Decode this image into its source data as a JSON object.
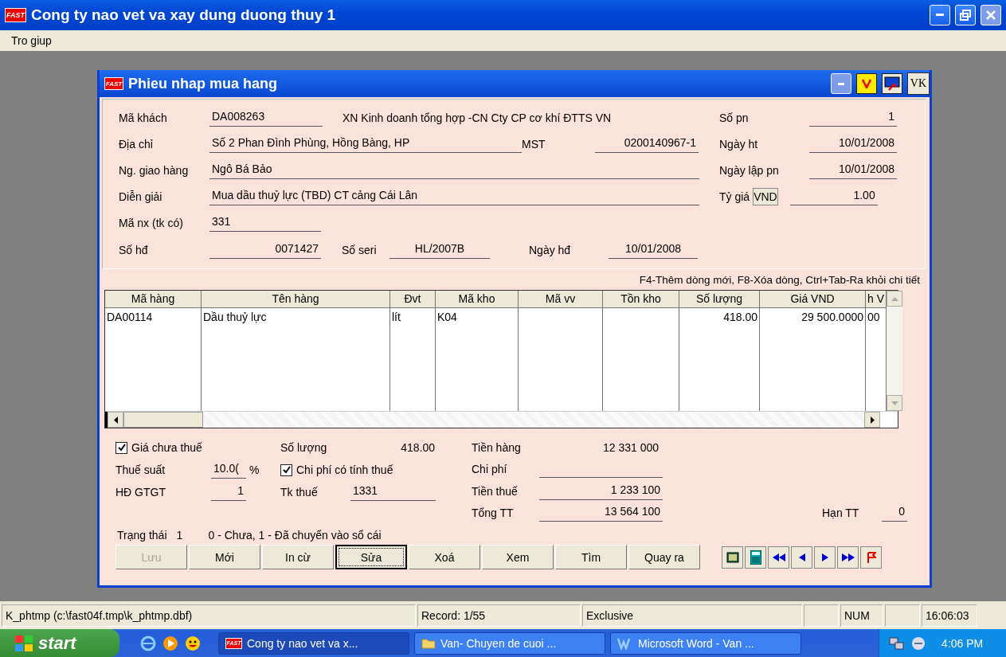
{
  "window": {
    "logo": "FAST",
    "title": "Cong ty nao vet va xay dung duong thuy 1"
  },
  "menu": [
    "Tro giup"
  ],
  "dialog": {
    "logo": "FAST",
    "title": "Phieu nhap mua hang",
    "corner_label": "VK",
    "customer_code": {
      "label": "Mã khách",
      "value": "DA008263",
      "name": "XN Kinh doanh tổng hợp -CN Cty CP cơ khí ĐTTS VN"
    },
    "address": {
      "label": "Địa chỉ",
      "value": "Số 2 Phan Đình Phùng, Hồng Bàng, HP",
      "tax_label": "MST",
      "tax_value": "0200140967-1"
    },
    "deliverer": {
      "label": "Ng. giao hàng",
      "value": "Ngô Bá Bảo"
    },
    "description": {
      "label": "Diễn giải",
      "value": "Mua dầu thuỷ lực (TBD) CT cảng Cái Lân"
    },
    "account": {
      "label": "Mã nx (tk có)",
      "value": "331"
    },
    "invoice": {
      "label": "Số hđ",
      "value": "0071427",
      "serial_label": "Số seri",
      "serial_value": "HL/2007B",
      "date_label": "Ngày hđ",
      "date_value": "10/01/2008"
    },
    "right_fields": [
      {
        "label": "Số pn",
        "value": "1"
      },
      {
        "label": "Ngày ht",
        "value": "10/01/2008"
      },
      {
        "label": "Ngày lập pn",
        "value": "10/01/2008"
      },
      {
        "label": "Tỷ giá",
        "currency": "VND",
        "value": "1.00"
      }
    ],
    "hint": "F4-Thêm dòng mới, F8-Xóa dòng, Ctrl+Tab-Ra khỏi chi tiết",
    "table": {
      "columns": [
        "Mã hàng",
        "Tên hàng",
        "Đvt",
        "Mã kho",
        "Mã vv",
        "Tồn kho",
        "Số lượng",
        "Giá VND",
        "h V"
      ],
      "rows": [
        [
          "DA00114",
          "Dầu thuỷ lực",
          "lít",
          "K04",
          "",
          "",
          "418.00",
          "29 500.0000",
          "00"
        ]
      ]
    },
    "price_excl_tax": {
      "label": "Giá chưa thuế",
      "checked": true
    },
    "tax_rate": {
      "label": "Thuế suất",
      "value": "10.0(",
      "unit": "%"
    },
    "vat_invoice": {
      "label": "HĐ GTGT",
      "value": "1"
    },
    "quantity": {
      "label": "Số lượng",
      "value": "418.00"
    },
    "cost_taxable": {
      "label": "Chi phí có tính thuế",
      "checked": true
    },
    "tax_account": {
      "label": "Tk thuế",
      "value": "1331"
    },
    "goods_amount": {
      "label": "Tiền hàng",
      "value": "12 331 000"
    },
    "cost": {
      "label": "Chi phí"
    },
    "tax_amount": {
      "label": "Tiền thuế",
      "value": "1 233 100"
    },
    "total": {
      "label": "Tổng TT",
      "value": "13 564 100"
    },
    "due": {
      "label": "Hạn TT",
      "value": "0"
    },
    "status": {
      "label": "Trạng thái",
      "value": "1",
      "legend": "0 - Chưa, 1 - Đã chuyển vào sổ cái"
    },
    "buttons": [
      {
        "label": "Lưu",
        "disabled": true,
        "focused": false
      },
      {
        "label": "Mới",
        "disabled": false,
        "focused": false
      },
      {
        "label": "In cừ",
        "disabled": false,
        "focused": false
      },
      {
        "label": "Sửa",
        "disabled": false,
        "focused": true
      },
      {
        "label": "Xoá",
        "disabled": false,
        "focused": false
      },
      {
        "label": "Xem",
        "disabled": false,
        "focused": false
      },
      {
        "label": "Tìm",
        "disabled": false,
        "focused": false
      },
      {
        "label": "Quay ra",
        "disabled": false,
        "focused": false
      }
    ],
    "nav_buttons": [
      {
        "kind": "ledger"
      },
      {
        "kind": "calculator"
      },
      {
        "kind": "first"
      },
      {
        "kind": "prev"
      },
      {
        "kind": "next"
      },
      {
        "kind": "last"
      },
      {
        "kind": "flag"
      }
    ]
  },
  "status_bar": {
    "file": "K_phtmp (c:\\fast04f.tmp\\k_phtmp.dbf)",
    "record": "Record: 1/55",
    "mode": "Exclusive",
    "num_lock": "NUM",
    "time": "16:06:03"
  },
  "taskbar": {
    "start": "start",
    "tasks": [
      {
        "label": "Cong ty nao vet va x...",
        "logo": "FAST",
        "kind": "app",
        "selected": true
      },
      {
        "label": "Van- Chuyen de cuoi ...",
        "kind": "folder",
        "selected": false
      },
      {
        "label": "Microsoft Word - Van ...",
        "kind": "word",
        "selected": false
      }
    ],
    "clock": "4:06 PM"
  }
}
